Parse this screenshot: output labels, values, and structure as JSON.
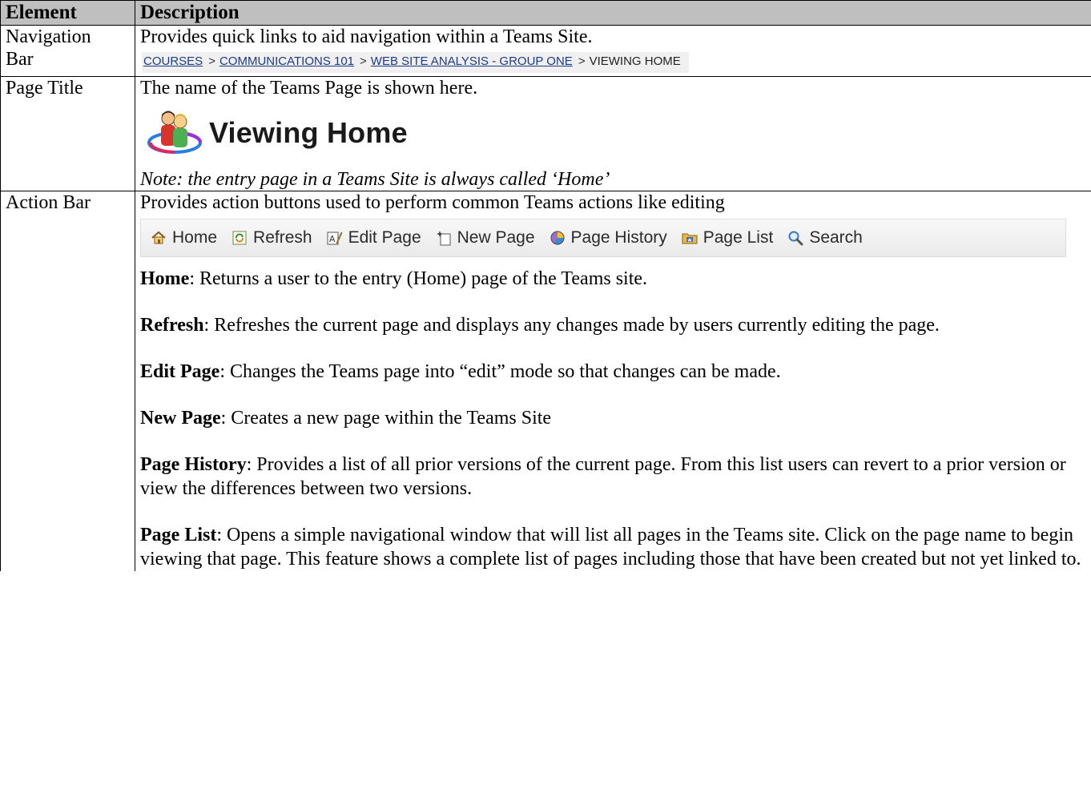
{
  "table": {
    "headers": {
      "element": "Element",
      "description": "Description"
    },
    "rows": {
      "navigation": {
        "element_line1": "Navigation",
        "element_line2": "Bar",
        "description": "Provides quick links to aid navigation within a Teams Site.",
        "breadcrumb": {
          "links": [
            "COURSES",
            "COMMUNICATIONS 101",
            "WEB SITE ANALYSIS - GROUP ONE"
          ],
          "separator": ">",
          "current": "VIEWING HOME"
        }
      },
      "page_title": {
        "element": "Page Title",
        "description": "The name of the Teams Page is shown here.",
        "title_text": "Viewing Home",
        "note": "Note: the entry page in a Teams Site is always called ‘Home’"
      },
      "action_bar": {
        "element": "Action Bar",
        "description": "Provides action buttons used to perform common Teams actions like editing",
        "buttons": [
          {
            "label": "Home",
            "icon": "home-icon"
          },
          {
            "label": "Refresh",
            "icon": "refresh-icon"
          },
          {
            "label": "Edit Page",
            "icon": "edit-page-icon"
          },
          {
            "label": "New Page",
            "icon": "new-page-icon"
          },
          {
            "label": "Page History",
            "icon": "page-history-icon"
          },
          {
            "label": "Page List",
            "icon": "page-list-icon"
          },
          {
            "label": "Search",
            "icon": "search-icon"
          }
        ],
        "definitions": [
          {
            "term": "Home",
            "text": ": Returns a user to the entry (Home) page of the Teams site."
          },
          {
            "term": "Refresh",
            "text": ": Refreshes the current page and displays any changes made by users currently editing the page."
          },
          {
            "term": "Edit Page",
            "text": ": Changes the Teams page into “edit” mode so that changes can be made."
          },
          {
            "term": "New Page",
            "text": ": Creates a new page within the Teams Site"
          },
          {
            "term": "Page History",
            "text": ": Provides a list of all prior versions of the current page.  From this list users can revert to a prior version or view the differences between two versions."
          },
          {
            "term": "Page List",
            "text": ": Opens a simple navigational window that will list all pages in the Teams site.  Click on the page name to begin viewing that page.  This feature shows a complete list of pages including those that have been created but not yet linked to."
          }
        ]
      }
    }
  }
}
